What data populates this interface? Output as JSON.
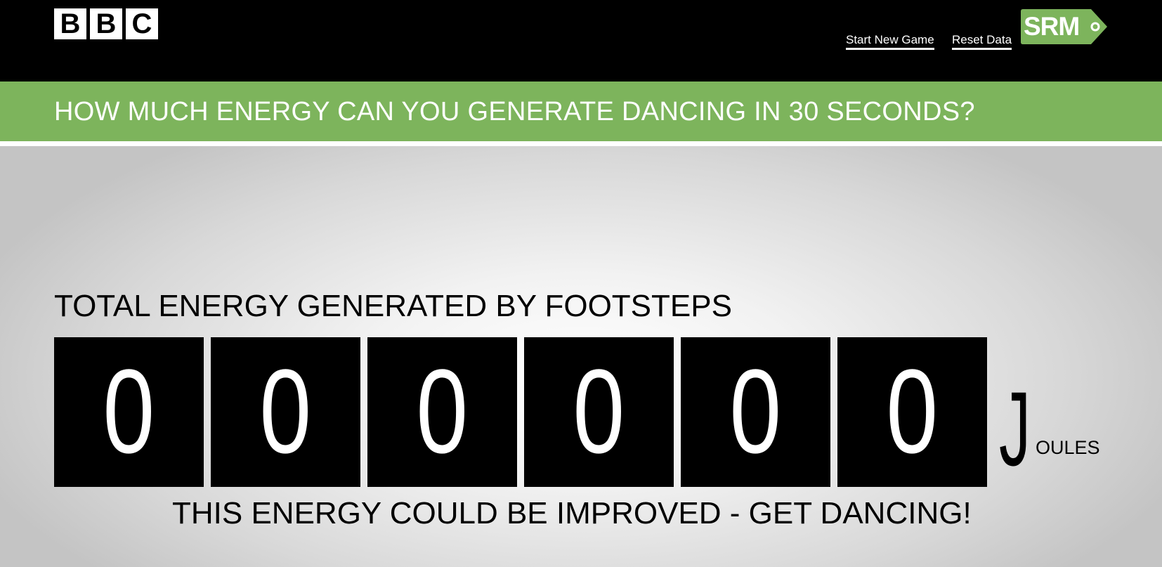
{
  "header": {
    "logo_letters": [
      "B",
      "B",
      "C"
    ],
    "nav": {
      "start_new_game": "Start New Game",
      "reset_data": "Reset Data"
    },
    "srm_label": "SRM",
    "colors": {
      "background": "#000000",
      "text": "#ffffff",
      "srm_tag": "#7db45c"
    }
  },
  "banner": {
    "title": "HOW MUCH ENERGY CAN YOU GENERATE DANCING IN 30 SECONDS?",
    "color": "#7db45c"
  },
  "main": {
    "total_label": "TOTAL ENERGY GENERATED BY FOOTSTEPS",
    "counter_digits": [
      "0",
      "0",
      "0",
      "0",
      "0",
      "0"
    ],
    "unit_initial": "J",
    "unit_rest": "OULES",
    "message": "THIS ENERGY COULD BE IMPROVED - GET DANCING!"
  }
}
